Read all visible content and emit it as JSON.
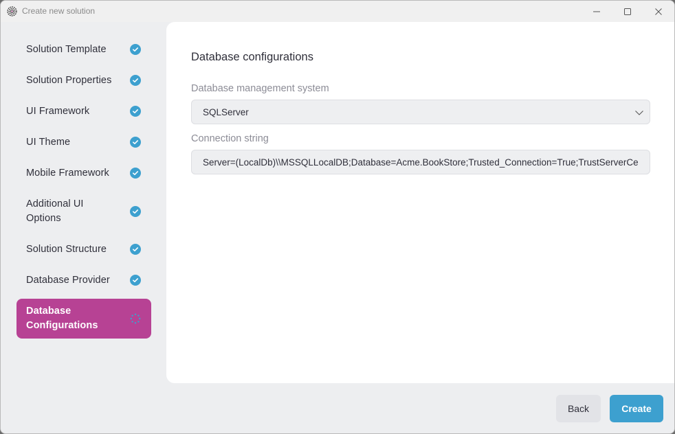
{
  "window": {
    "title": "Create new solution",
    "controls": {
      "minimize": "minimize",
      "maximize": "maximize",
      "close": "close"
    }
  },
  "sidebar": {
    "items": [
      {
        "label": "Solution Template",
        "status": "completed",
        "icon": "check-circle-icon"
      },
      {
        "label": "Solution Properties",
        "status": "completed",
        "icon": "check-circle-icon"
      },
      {
        "label": "UI Framework",
        "status": "completed",
        "icon": "check-circle-icon"
      },
      {
        "label": "UI Theme",
        "status": "completed",
        "icon": "check-circle-icon"
      },
      {
        "label": "Mobile Framework",
        "status": "completed",
        "icon": "check-circle-icon"
      },
      {
        "label": "Additional UI Options",
        "status": "completed",
        "icon": "check-circle-icon"
      },
      {
        "label": "Solution Structure",
        "status": "completed",
        "icon": "check-circle-icon"
      },
      {
        "label": "Database Provider",
        "status": "completed",
        "icon": "check-circle-icon"
      },
      {
        "label": "Database Configurations",
        "status": "in-progress",
        "icon": "loading-spinner-icon"
      }
    ]
  },
  "main": {
    "title": "Database configurations",
    "dbms": {
      "label": "Database management system",
      "value": "SQLServer"
    },
    "connection_string": {
      "label": "Connection string",
      "value": "Server=(LocalDb)\\\\MSSQLLocalDB;Database=Acme.BookStore;Trusted_Connection=True;TrustServerCertificate=True"
    }
  },
  "footer": {
    "back_label": "Back",
    "create_label": "Create"
  },
  "colors": {
    "accent": "#b74294",
    "check": "#3da0cf",
    "primary_button": "#3da0cf"
  }
}
